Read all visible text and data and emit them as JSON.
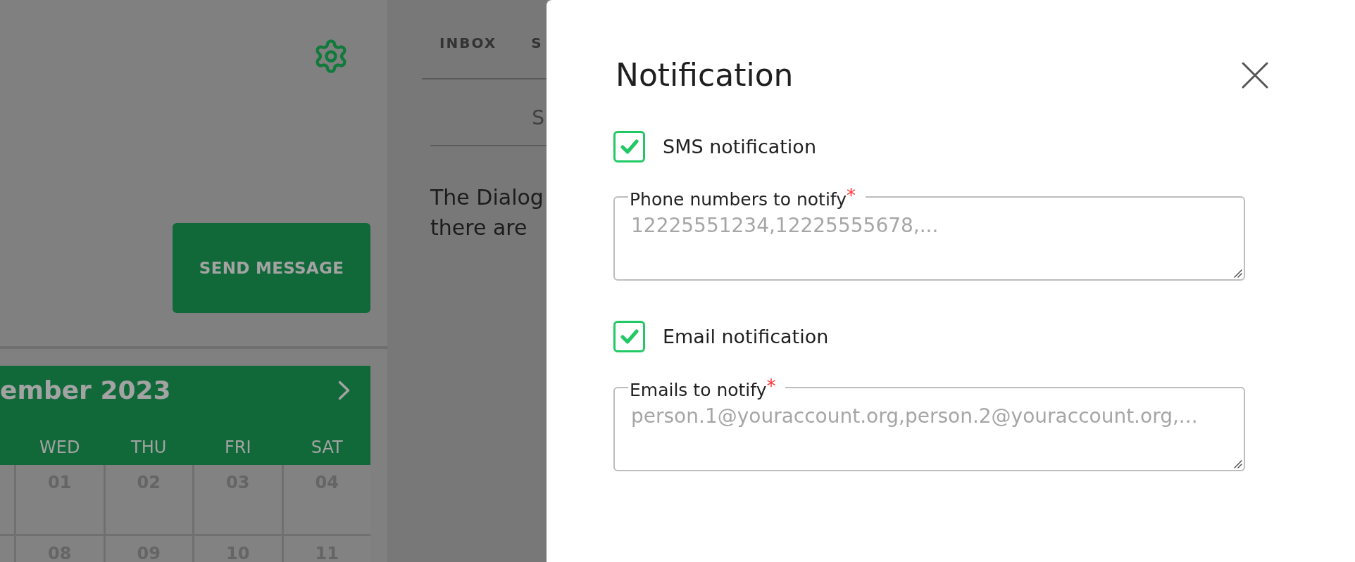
{
  "sidebar": {
    "send_button": {
      "label": "SEND MESSAGE"
    },
    "calendar": {
      "title": "ember 2023",
      "weekdays": [
        "WED",
        "THU",
        "FRI",
        "SAT"
      ],
      "weeks": [
        [
          "01",
          "02",
          "03",
          "04"
        ],
        [
          "08",
          "09",
          "10",
          "11"
        ]
      ]
    }
  },
  "inbox": {
    "tabs": [
      {
        "label": "INBOX"
      },
      {
        "label": "S"
      }
    ],
    "search": {
      "placeholder": "S"
    },
    "body_lines": [
      "The Dialog",
      "there are"
    ]
  },
  "dialog": {
    "title": "Notification",
    "notifications": [
      {
        "label": "SMS notification",
        "checked": true,
        "field_label": "Phone numbers to notify$^{*}$",
        "placeholder": "12225551234,12225555678,..."
      },
      {
        "label": "Email notification",
        "checked": true,
        "field_label": "Emails to notify$^{*}$",
        "placeholder": "person.1@youraccount.org,person.2@youraccount.org,..."
      }
    ]
  }
}
